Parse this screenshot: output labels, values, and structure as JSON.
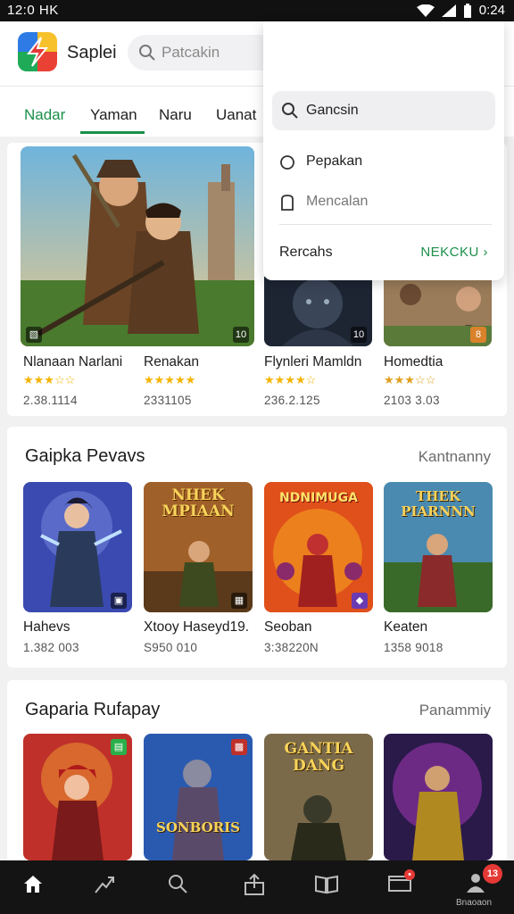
{
  "status": {
    "time_left": "12:0 HK",
    "time_right": "0:24"
  },
  "appbar": {
    "app_name": "Saplei",
    "search_placeholder": "Patcakin",
    "icons": [
      "app-logo",
      "search-icon",
      "notification-bell-icon",
      "more-vert-icon"
    ]
  },
  "tabs": [
    {
      "label": "Nadar",
      "active": true
    },
    {
      "label": "Yaman",
      "active": false
    },
    {
      "label": "Naru",
      "active": false
    },
    {
      "label": "Uanat",
      "active": false
    }
  ],
  "dropdown": {
    "search_label": "Gancsin",
    "items": [
      {
        "label": "Pepakan",
        "icon": "circle-icon"
      },
      {
        "label": "Mencalan",
        "icon": "doc-icon"
      }
    ],
    "footer_left": "Rercahs",
    "footer_right": "NEKCKU"
  },
  "featured": {
    "cards": [
      {
        "title": "Nlanaan Narlani",
        "stars": "★★★☆☆",
        "count": "2.38.1114",
        "badge": "▧"
      },
      {
        "title": "Renakan",
        "stars": "★★★★★",
        "count": "2331105",
        "badge": ""
      },
      {
        "title": "Flynleri Mamldn",
        "stars": "★★★★☆",
        "count": "236.2.125",
        "badge": "10"
      },
      {
        "title": "Homedtia",
        "stars": "★★★☆☆",
        "count": "2103 3.03",
        "badge": "8"
      }
    ]
  },
  "section1": {
    "title": "Gaipka Pevavs",
    "link": "Kantnanny",
    "cards": [
      {
        "title": "Hahevs",
        "count": "1.382 003",
        "art_text": ""
      },
      {
        "title": "Xtooy Haseyd19.",
        "count": "S950 010",
        "art_text": "NHEK MPIAAN"
      },
      {
        "title": "Seoban",
        "count": "3:38220N",
        "art_text": "NDNIMUGA"
      },
      {
        "title": "Keaten",
        "count": "1358 9018",
        "art_text": "THEK PIARNNN"
      }
    ]
  },
  "section2": {
    "title": "Gaparia Rufapay",
    "link": "Panammiy",
    "cards": [
      {
        "art_text": ""
      },
      {
        "art_text": "SONBORIS"
      },
      {
        "art_text": "GANTIA DANG"
      },
      {
        "art_text": ""
      }
    ]
  },
  "bottom_nav": {
    "items": [
      "home-icon",
      "trending-icon",
      "search-icon",
      "share-icon",
      "library-icon",
      "inbox-icon",
      "profile-icon"
    ],
    "inbox_badge": "•",
    "profile_badge": "13",
    "profile_label": "Bnaoaon"
  },
  "colors": {
    "accent": "#1a8f4a",
    "star": "#f4b400",
    "background": "#f1f1f1",
    "nav_bg": "#141414"
  }
}
